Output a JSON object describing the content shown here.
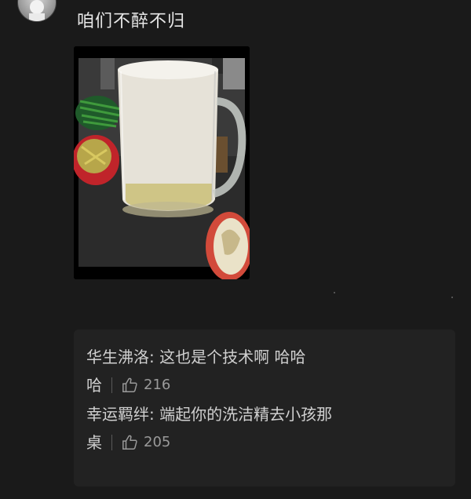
{
  "post": {
    "text": "咱们不醉不归"
  },
  "comments": [
    {
      "text_line1": "华生沸洛: 这也是个技术啊 哈哈",
      "text_line2": "哈",
      "likes": "216"
    },
    {
      "text_line1": "幸运羁绊: 端起你的洗洁精去小孩那",
      "text_line2": "桌",
      "likes": "205"
    }
  ],
  "icons": {
    "avatar": "avatar",
    "like": "thumbs-up-icon"
  },
  "colors": {
    "background": "#1a1a1a",
    "comment_box": "#222222",
    "text": "#e6e6e6"
  }
}
